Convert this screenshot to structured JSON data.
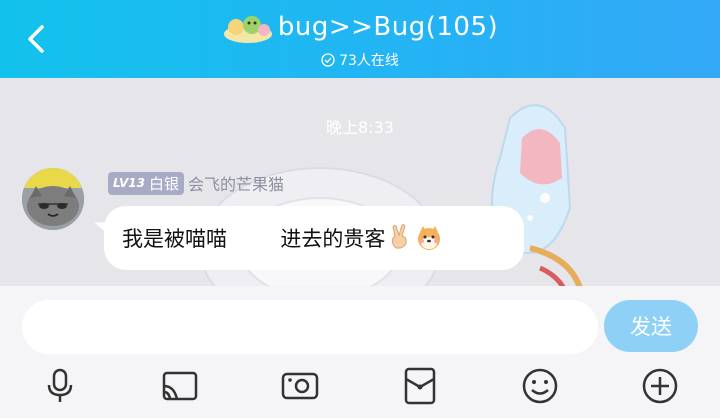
{
  "header": {
    "title": "bug>>Bug(105)",
    "online_count": "73人在线",
    "back_icon": "chevron-left-icon"
  },
  "chat": {
    "timestamp": "晚上8:33",
    "message": {
      "level": "LV13",
      "title_badge": "白银",
      "sender": "会飞的芒果猫",
      "text": "我是被喵喵        进去的贵客"
    }
  },
  "input": {
    "placeholder": "",
    "value": "",
    "send_label": "发送"
  },
  "toolbar": {
    "items": [
      "microphone-icon",
      "screen-cast-icon",
      "photo-icon",
      "red-packet-icon",
      "emoji-icon",
      "plus-icon"
    ]
  },
  "colors": {
    "header_gradient_start": "#12c2ec",
    "header_gradient_end": "#34a9f7",
    "send_button": "#8fd0f6",
    "level_badge": "#a7abc6"
  }
}
